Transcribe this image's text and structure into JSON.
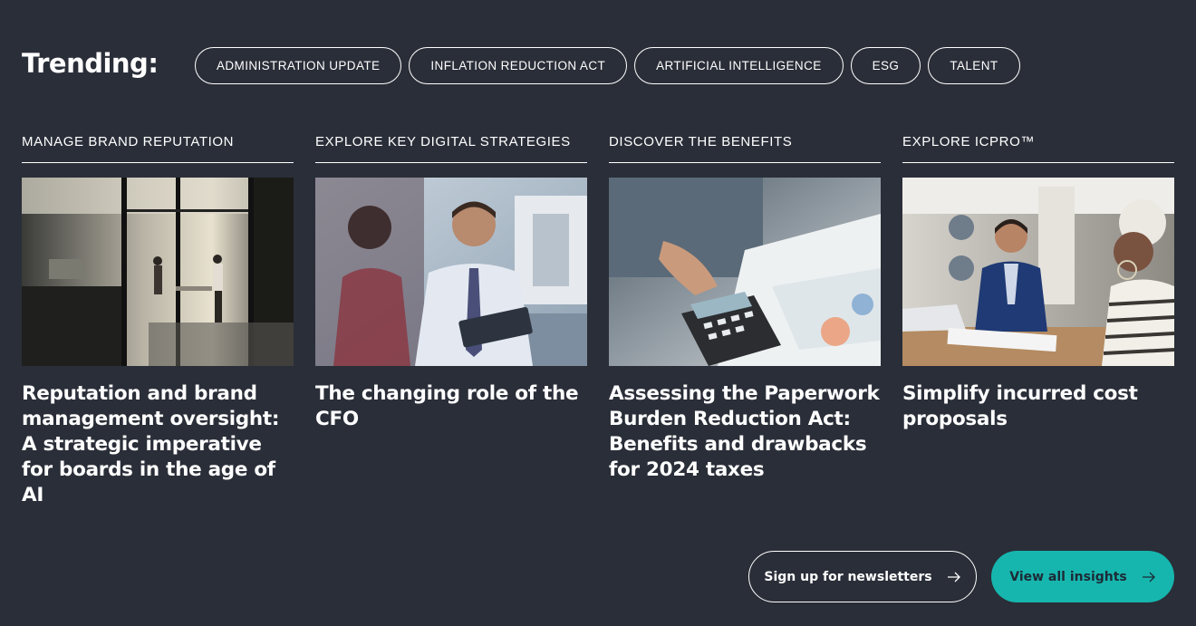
{
  "trending": {
    "label": "Trending:",
    "chips": [
      "ADMINISTRATION UPDATE",
      "INFLATION REDUCTION ACT",
      "ARTIFICIAL INTELLIGENCE",
      "ESG",
      "TALENT"
    ]
  },
  "cards": [
    {
      "eyebrow": "MANAGE BRAND REPUTATION",
      "title": "Reputation and brand management oversight: A strategic imperative for boards in the age of AI",
      "image": "office-meeting-photo"
    },
    {
      "eyebrow": "EXPLORE KEY DIGITAL STRATEGIES",
      "title": "The changing role of the CFO",
      "image": "executive-with-tablet-photo"
    },
    {
      "eyebrow": "DISCOVER THE BENEFITS",
      "title": "Assessing the Paperwork Burden Reduction Act: Benefits and drawbacks for 2024 taxes",
      "image": "calculator-paperwork-photo"
    },
    {
      "eyebrow": "EXPLORE ICPRO™",
      "title": "Simplify incurred cost proposals",
      "image": "advisor-client-meeting-photo"
    }
  ],
  "actions": {
    "newsletter_label": "Sign up for newsletters",
    "insights_label": "View all insights"
  },
  "colors": {
    "background": "#2a2e38",
    "accent": "#16b6ae",
    "text": "#ffffff"
  }
}
